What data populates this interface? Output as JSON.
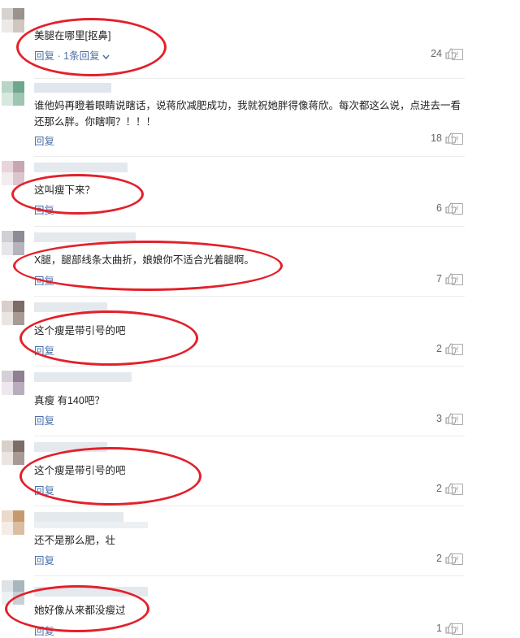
{
  "comments": [
    {
      "text": "美腿在哪里[抠鼻]",
      "reply": "回复",
      "more": " · 1条回复",
      "likes": "24"
    },
    {
      "text": "谁他妈再瞪着眼睛说瞎话，说蒋欣减肥成功，我就祝她胖得像蒋欣。每次都这么说，点进去一看还那么胖。你瞎啊？！！！",
      "reply": "回复",
      "likes": "18"
    },
    {
      "text": "这叫瘦下来？",
      "reply": "回复",
      "likes": "6"
    },
    {
      "text": "X腿，腿部线条太曲折，娘娘你不适合光着腿啊。",
      "reply": "回复",
      "likes": "7"
    },
    {
      "text": "这个瘦是带引号的吧",
      "reply": "回复",
      "likes": "2"
    },
    {
      "text": "真瘦 有140吧？",
      "reply": "回复",
      "likes": "3"
    },
    {
      "text": "这个瘦是带引号的吧",
      "reply": "回复",
      "likes": "2"
    },
    {
      "text": "还不是那么肥，壮",
      "reply": "回复",
      "likes": "2"
    },
    {
      "text": "她好像从来都没瘦过",
      "reply": "回复",
      "likes": "1"
    }
  ],
  "icons": {
    "like": "thumbs-up-icon",
    "report": "report-flag-icon",
    "expand": "chevron-down-icon"
  },
  "colors": {
    "highlight_circle": "#e3202a",
    "reply_link": "#4a6fa8"
  }
}
